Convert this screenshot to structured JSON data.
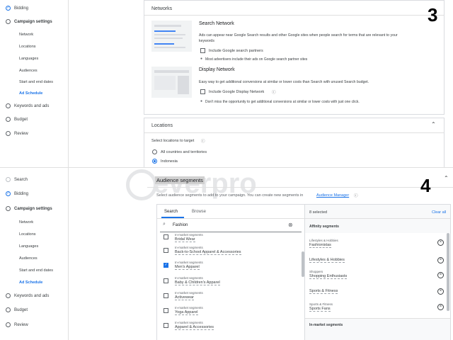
{
  "top": {
    "sidebar": {
      "bidding": "Bidding",
      "campaign_settings": "Campaign settings",
      "subs": [
        "Network",
        "Locations",
        "Languages",
        "Audiences",
        "Start and end dates",
        "Ad Schedule"
      ],
      "keywords": "Keywords and ads",
      "budget": "Budget",
      "review": "Review"
    },
    "networks": {
      "title": "Networks",
      "search_title": "Search Network",
      "search_desc_1": "Ads can appear near Google Search results and other Google sites when people search for terms that are relevant to your",
      "search_desc_2": "keywords",
      "search_partners": "Include Google search partners",
      "search_note": "Most advertisers include their ads on Google search partner sites",
      "display_title": "Display Network",
      "display_desc": "Easy way to get additional conversions at similar or lower costs than Search with unused Search budget.",
      "display_include": "Include Google Display Network",
      "display_note": "Don't miss the opportunity to get additional conversions at similar or lower costs with just one click."
    },
    "locations": {
      "title": "Locations",
      "select_label": "Select locations to target",
      "all": "All countries and territories",
      "indonesia": "Indonesia"
    },
    "step_number": "3"
  },
  "bottom": {
    "sidebar": {
      "search": "Search",
      "bidding": "Bidding",
      "campaign_settings": "Campaign settings",
      "subs": [
        "Network",
        "Locations",
        "Languages",
        "Audiences",
        "Start and end dates",
        "Ad Schedule"
      ],
      "keywords": "Keywords and ads",
      "budget": "Budget",
      "review": "Review"
    },
    "audience": {
      "title": "Audience segments",
      "desc": "Select audience segments to add to your campaign. You can create new segments in",
      "manager_link": "Audience Manager",
      "tab_search": "Search",
      "tab_browse": "Browse",
      "search_value": "Fashion",
      "results": [
        {
          "type": "In-market segments",
          "name": "Bridal Wear",
          "checked": false
        },
        {
          "type": "In-market segments",
          "name": "Back-to-School Apparel & Accessories",
          "checked": false
        },
        {
          "type": "In-market segments",
          "name": "Men's Apparel",
          "checked": true
        },
        {
          "type": "In-market segments",
          "name": "Baby & Children's Apparel",
          "checked": false
        },
        {
          "type": "In-market segments",
          "name": "Activewear",
          "checked": false
        },
        {
          "type": "In-market segments",
          "name": "Yoga Apparel",
          "checked": false
        },
        {
          "type": "In-market segments",
          "name": "Apparel & Accessories",
          "checked": false
        }
      ],
      "selected_count": "8 selected",
      "clear_all": "Clear all",
      "affinity_header": "Affinity segments",
      "selected": [
        {
          "parent": "Lifestyles & Hobbies",
          "name": "Fashionistas"
        },
        {
          "parent": "",
          "name": "Lifestyles & Hobbies"
        },
        {
          "parent": "Shoppers",
          "name": "Shopping Enthusiasts"
        },
        {
          "parent": "",
          "name": "Sports & Fitness"
        },
        {
          "parent": "Sports & Fitness",
          "name": "Sports Fans"
        }
      ],
      "inmarket_header": "In-market segments"
    },
    "step_number": "4",
    "watermark": "everpro"
  },
  "colors": {
    "accent": "#1a73e8",
    "border": "#dadce0",
    "panel_bg": "#f8f9fa"
  }
}
